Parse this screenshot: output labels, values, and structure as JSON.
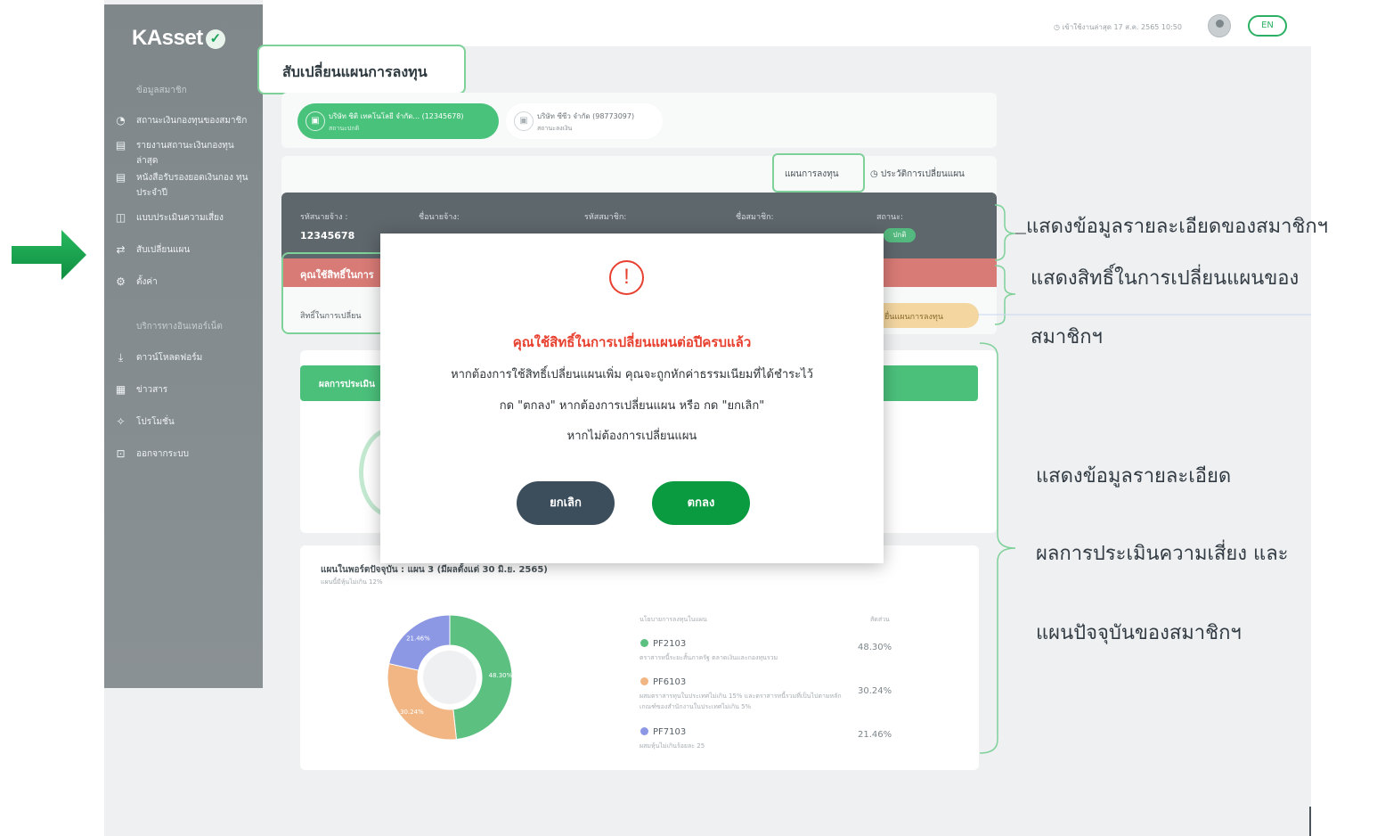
{
  "sidebar": {
    "logo": "KAsset",
    "logo_mark": "✓",
    "section_member": "ข้อมูลสมาชิก",
    "section_online": "บริการทางอินเทอร์เน็ต",
    "items": [
      {
        "label": "สถานะเงินกองทุนของสมาชิก",
        "icon": "chart-icon",
        "glyph": "◔"
      },
      {
        "label": "รายงานสถานะเงินกองทุน ล่าสุด",
        "icon": "report-icon",
        "glyph": "▤"
      },
      {
        "label": "หนังสือรับรองยอดเงินกอง ทุนประจำปี",
        "icon": "certificate-icon",
        "glyph": "▤"
      },
      {
        "label": "แบบประเมินความเสี่ยง",
        "icon": "assessment-icon",
        "glyph": "◫"
      },
      {
        "label": "สับเปลี่ยนแผน",
        "icon": "switch-plan-icon",
        "glyph": "⇄"
      },
      {
        "label": "ตั้งค่า",
        "icon": "gear-icon",
        "glyph": "⚙"
      },
      {
        "label": "ดาวน์โหลดฟอร์ม",
        "icon": "download-icon",
        "glyph": "⤓"
      },
      {
        "label": "ข่าวสาร",
        "icon": "news-icon",
        "glyph": "▦"
      },
      {
        "label": "โปรโมชั่น",
        "icon": "megaphone-icon",
        "glyph": "✧"
      },
      {
        "label": "ออกจากระบบ",
        "icon": "lock-icon",
        "glyph": "⊡"
      }
    ]
  },
  "topbar": {
    "last_login": "เข้าใช้งานล่าสุด 17 ส.ค. 2565  10:50",
    "language": "EN"
  },
  "page_title": "สับเปลี่ยนแผนการลงทุน",
  "companies": [
    {
      "name": "บริษัท ซิติ เทคโนโลยี จำกัด... (12345678)",
      "status": "สถานะปกติ"
    },
    {
      "name": "บริษัท ซีซีว จำกัด (98773097)",
      "status": "สถานะลงเงิน"
    }
  ],
  "tabs": {
    "investment_plan": "แผนการลงทุน",
    "history": "ประวัติการเปลี่ยนแผน"
  },
  "member_info": {
    "employer_code_label": "รหัสนายจ้าง :",
    "employer_code": "12345678",
    "employer_name_label": "ชื่อนายจ้าง:",
    "member_code_label": "รหัสสมาชิก:",
    "member_name_label": "ชื่อสมาชิก:",
    "status_label": "สถานะ:",
    "status_value": "ปกติ"
  },
  "rights": {
    "title": "คุณใช้สิทธิ์ในการ",
    "text": "สิทธิ์ในการเปลี่ยน",
    "change_plan_button": "ยื่นแผนการลงทุน"
  },
  "result": {
    "title": "ผลการประเมิน"
  },
  "portfolio": {
    "title": "แผนในพอร์ตปัจจุบัน : แผน 3 (มีผลตั้งแต่ 30 มิ.ย. 2565)",
    "subtitle": "แผนนี้มีหุ้นไม่เกิน 12%",
    "legend_header": "นโยบายการลงทุนในแผน",
    "legend_header_right": "สัดส่วน",
    "chart_data": {
      "type": "pie",
      "categories": [
        "PF2103",
        "PF6103",
        "PF7103"
      ],
      "values": [
        48.3,
        30.24,
        21.46
      ],
      "labels": [
        "48.30%",
        "30.24%",
        "21.46%"
      ],
      "colors": [
        "#5cc080",
        "#f1b684",
        "#8c98e4"
      ]
    },
    "funds": [
      {
        "code": "PF2103",
        "desc": "ตราสารหนี้ระยะสั้นภาครัฐ ตลาดเงินและกองทุนรวม",
        "pct": "48.30%",
        "color": "#5cc080"
      },
      {
        "code": "PF6103",
        "desc": "ผสมตราสารทุนในประเทศไม่เกิน 15% และตราสารหนี้รวมที่เป็นไปตามหลักเกณฑ์ของสำนักงานในประเทศไม่เกิน 5%",
        "pct": "30.24%",
        "color": "#f1b684"
      },
      {
        "code": "PF7103",
        "desc": "ผสมหุ้นไม่เกินร้อยละ 25",
        "pct": "21.46%",
        "color": "#8c98e4"
      }
    ]
  },
  "modal": {
    "icon": "!",
    "title": "คุณใช้สิทธิ์ในการเปลี่ยนแผนต่อปีครบแล้ว",
    "line1": "หากต้องการใช้สิทธิ์เปลี่ยนแผนเพิ่ม คุณจะถูกหักค่าธรรมเนียมที่ได้ชำระไว้",
    "line2": "กด \"ตกลง\" หากต้องการเปลี่ยนแผน หรือ กด \"ยกเลิก\"",
    "line3": "หากไม่ต้องการเปลี่ยนแผน",
    "cancel": "ยกเลิก",
    "ok": "ตกลง"
  },
  "annotations": {
    "member_detail": "แสดงข้อมูลรายละเอียดของสมาชิกฯ",
    "rights_line1": "แสดงสิทธิ์ในการเปลี่ยนแผนของ",
    "rights_line2": "สมาชิกฯ",
    "result_line1": "แสดงข้อมูลรายละเอียด",
    "result_line2": "ผลการประเมินความเสี่ยง และ",
    "result_line3": "แผนปัจจุบันของสมาชิกฯ"
  }
}
